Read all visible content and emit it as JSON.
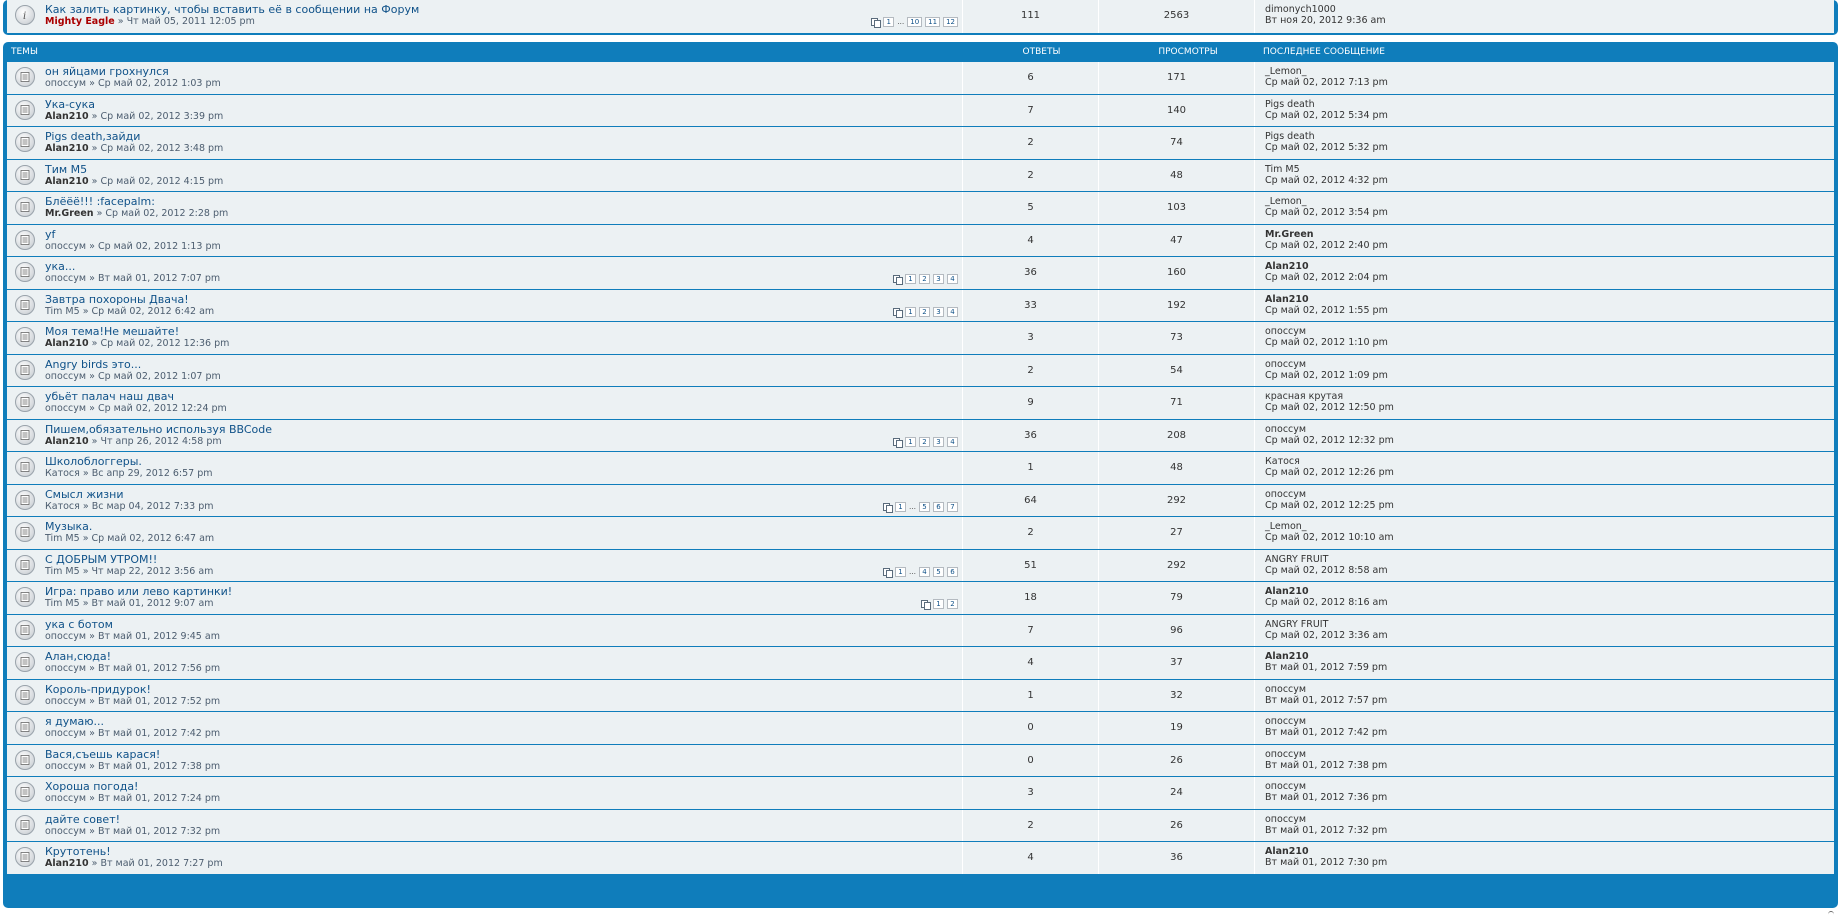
{
  "announcement": {
    "title": "Как залить картинку, чтобы вставить её в сообщении на Форум",
    "author": "Mighty Eagle",
    "date": "» Чт май 05, 2011 12:05 pm",
    "pages": [
      "1",
      "…",
      "10",
      "11",
      "12"
    ],
    "replies": "111",
    "views": "2563",
    "last_author": "dimonych1000",
    "last_date": "Вт ноя 20, 2012 9:36 am"
  },
  "header": {
    "topics": "Темы",
    "replies": "Ответы",
    "views": "Просмотры",
    "last": "Последнее сообщение"
  },
  "topics": [
    {
      "title": "он яйцами грохнулся",
      "author": "опоссум",
      "author_bold": false,
      "date": "» Ср май 02, 2012 1:03 pm",
      "pages": [],
      "replies": "6",
      "views": "171",
      "last_author": "_Lemon_",
      "last_bold": false,
      "last_date": "Ср май 02, 2012 7:13 pm"
    },
    {
      "title": "Ука-сука",
      "author": "Alan210",
      "author_bold": true,
      "date": "» Ср май 02, 2012 3:39 pm",
      "pages": [],
      "replies": "7",
      "views": "140",
      "last_author": "Pigs death",
      "last_bold": false,
      "last_date": "Ср май 02, 2012 5:34 pm"
    },
    {
      "title": "Pigs death,зайди",
      "author": "Alan210",
      "author_bold": true,
      "date": "» Ср май 02, 2012 3:48 pm",
      "pages": [],
      "replies": "2",
      "views": "74",
      "last_author": "Pigs death",
      "last_bold": false,
      "last_date": "Ср май 02, 2012 5:32 pm"
    },
    {
      "title": "Тим М5",
      "author": "Alan210",
      "author_bold": true,
      "date": "» Ср май 02, 2012 4:15 pm",
      "pages": [],
      "replies": "2",
      "views": "48",
      "last_author": "Tim M5",
      "last_bold": false,
      "last_date": "Ср май 02, 2012 4:32 pm"
    },
    {
      "title": "Блёёё!!! :facepalm:",
      "author": "Mr.Green",
      "author_bold": true,
      "date": "» Ср май 02, 2012 2:28 pm",
      "pages": [],
      "replies": "5",
      "views": "103",
      "last_author": "_Lemon_",
      "last_bold": false,
      "last_date": "Ср май 02, 2012 3:54 pm"
    },
    {
      "title": "yf",
      "author": "опоссум",
      "author_bold": false,
      "date": "» Ср май 02, 2012 1:13 pm",
      "pages": [],
      "replies": "4",
      "views": "47",
      "last_author": "Mr.Green",
      "last_bold": true,
      "last_date": "Ср май 02, 2012 2:40 pm"
    },
    {
      "title": "ука...",
      "author": "опоссум",
      "author_bold": false,
      "date": "» Вт май 01, 2012 7:07 pm",
      "pages": [
        "1",
        "2",
        "3",
        "4"
      ],
      "replies": "36",
      "views": "160",
      "last_author": "Alan210",
      "last_bold": true,
      "last_date": "Ср май 02, 2012 2:04 pm"
    },
    {
      "title": "Завтра похороны Двача!",
      "author": "Tim M5",
      "author_bold": false,
      "date": "» Ср май 02, 2012 6:42 am",
      "pages": [
        "1",
        "2",
        "3",
        "4"
      ],
      "replies": "33",
      "views": "192",
      "last_author": "Alan210",
      "last_bold": true,
      "last_date": "Ср май 02, 2012 1:55 pm"
    },
    {
      "title": "Моя тема!Не мешайте!",
      "author": "Alan210",
      "author_bold": true,
      "date": "» Ср май 02, 2012 12:36 pm",
      "pages": [],
      "replies": "3",
      "views": "73",
      "last_author": "опоссум",
      "last_bold": false,
      "last_date": "Ср май 02, 2012 1:10 pm"
    },
    {
      "title": "Angry birds это...",
      "author": "опоссум",
      "author_bold": false,
      "date": "» Ср май 02, 2012 1:07 pm",
      "pages": [],
      "replies": "2",
      "views": "54",
      "last_author": "опоссум",
      "last_bold": false,
      "last_date": "Ср май 02, 2012 1:09 pm"
    },
    {
      "title": "убьёт палач наш двач",
      "author": "опоссум",
      "author_bold": false,
      "date": "» Ср май 02, 2012 12:24 pm",
      "pages": [],
      "replies": "9",
      "views": "71",
      "last_author": "красная крутая",
      "last_bold": false,
      "last_date": "Ср май 02, 2012 12:50 pm"
    },
    {
      "title": "Пишем,обязательно используя BBCode",
      "author": "Alan210",
      "author_bold": true,
      "date": "» Чт апр 26, 2012 4:58 pm",
      "pages": [
        "1",
        "2",
        "3",
        "4"
      ],
      "replies": "36",
      "views": "208",
      "last_author": "опоссум",
      "last_bold": false,
      "last_date": "Ср май 02, 2012 12:32 pm"
    },
    {
      "title": "Школоблоггеры.",
      "author": "Катося",
      "author_bold": false,
      "date": "» Вс апр 29, 2012 6:57 pm",
      "pages": [],
      "replies": "1",
      "views": "48",
      "last_author": "Катося",
      "last_bold": false,
      "last_date": "Ср май 02, 2012 12:26 pm"
    },
    {
      "title": "Смысл жизни",
      "author": "Катося",
      "author_bold": false,
      "date": "» Вс мар 04, 2012 7:33 pm",
      "pages": [
        "1",
        "…",
        "5",
        "6",
        "7"
      ],
      "replies": "64",
      "views": "292",
      "last_author": "опоссум",
      "last_bold": false,
      "last_date": "Ср май 02, 2012 12:25 pm"
    },
    {
      "title": "Музыка.",
      "author": "Tim M5",
      "author_bold": false,
      "date": "» Ср май 02, 2012 6:47 am",
      "pages": [],
      "replies": "2",
      "views": "27",
      "last_author": "_Lemon_",
      "last_bold": false,
      "last_date": "Ср май 02, 2012 10:10 am"
    },
    {
      "title": "С ДОБРЫМ УТРОМ!!",
      "author": "Tim M5",
      "author_bold": false,
      "date": "» Чт мар 22, 2012 3:56 am",
      "pages": [
        "1",
        "…",
        "4",
        "5",
        "6"
      ],
      "replies": "51",
      "views": "292",
      "last_author": "ANGRY FRUIT",
      "last_bold": false,
      "last_date": "Ср май 02, 2012 8:58 am"
    },
    {
      "title": "Игра: право или лево картинки!",
      "author": "Tim M5",
      "author_bold": false,
      "date": "» Вт май 01, 2012 9:07 am",
      "pages": [
        "1",
        "2"
      ],
      "replies": "18",
      "views": "79",
      "last_author": "Alan210",
      "last_bold": true,
      "last_date": "Ср май 02, 2012 8:16 am"
    },
    {
      "title": "ука с ботом",
      "author": "опоссум",
      "author_bold": false,
      "date": "» Вт май 01, 2012 9:45 am",
      "pages": [],
      "replies": "7",
      "views": "96",
      "last_author": "ANGRY FRUIT",
      "last_bold": false,
      "last_date": "Ср май 02, 2012 3:36 am"
    },
    {
      "title": "Алан,сюда!",
      "author": "опоссум",
      "author_bold": false,
      "date": "» Вт май 01, 2012 7:56 pm",
      "pages": [],
      "replies": "4",
      "views": "37",
      "last_author": "Alan210",
      "last_bold": true,
      "last_date": "Вт май 01, 2012 7:59 pm"
    },
    {
      "title": "Король-придурок!",
      "author": "опоссум",
      "author_bold": false,
      "date": "» Вт май 01, 2012 7:52 pm",
      "pages": [],
      "replies": "1",
      "views": "32",
      "last_author": "опоссум",
      "last_bold": false,
      "last_date": "Вт май 01, 2012 7:57 pm"
    },
    {
      "title": "я думаю...",
      "author": "опоссум",
      "author_bold": false,
      "date": "» Вт май 01, 2012 7:42 pm",
      "pages": [],
      "replies": "0",
      "views": "19",
      "last_author": "опоссум",
      "last_bold": false,
      "last_date": "Вт май 01, 2012 7:42 pm"
    },
    {
      "title": "Вася,съешь карася!",
      "author": "опоссум",
      "author_bold": false,
      "date": "» Вт май 01, 2012 7:38 pm",
      "pages": [],
      "replies": "0",
      "views": "26",
      "last_author": "опоссум",
      "last_bold": false,
      "last_date": "Вт май 01, 2012 7:38 pm"
    },
    {
      "title": "Хороша погода!",
      "author": "опоссум",
      "author_bold": false,
      "date": "» Вт май 01, 2012 7:24 pm",
      "pages": [],
      "replies": "3",
      "views": "24",
      "last_author": "опоссум",
      "last_bold": false,
      "last_date": "Вт май 01, 2012 7:36 pm"
    },
    {
      "title": "дайте совет!",
      "author": "опоссум",
      "author_bold": false,
      "date": "» Вт май 01, 2012 7:32 pm",
      "pages": [],
      "replies": "2",
      "views": "26",
      "last_author": "опоссум",
      "last_bold": false,
      "last_date": "Вт май 01, 2012 7:32 pm"
    },
    {
      "title": "Крутотень!",
      "author": "Alan210",
      "author_bold": true,
      "date": "» Вт май 01, 2012 7:27 pm",
      "pages": [],
      "replies": "4",
      "views": "36",
      "last_author": "Alan210",
      "last_bold": true,
      "last_date": "Вт май 01, 2012 7:30 pm"
    }
  ]
}
